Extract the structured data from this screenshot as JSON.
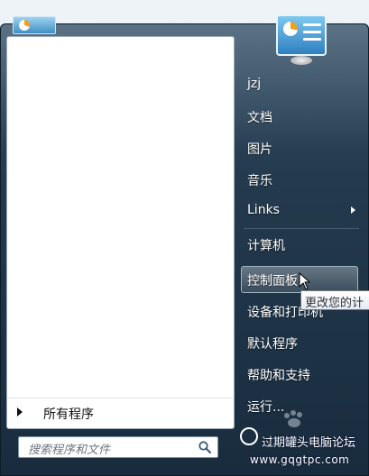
{
  "right_pane": {
    "user": "jzj",
    "items": [
      "文档",
      "图片",
      "音乐",
      "Links",
      "计算机",
      "控制面板",
      "设备和打印机",
      "默认程序",
      "帮助和支持",
      "运行..."
    ]
  },
  "left_pane": {
    "all_programs": "所有程序"
  },
  "search": {
    "placeholder": "搜索程序和文件"
  },
  "tooltip": "更改您的计",
  "watermark": {
    "line1": "过期罐头电脑论坛",
    "line2": "www.gqgtpc.com"
  },
  "colors": {
    "frame": "#1f3a52",
    "highlight_border": "#9cb3c4"
  },
  "icons": [
    "control-panel-icon",
    "search-icon",
    "arrow-right-icon",
    "cursor-icon"
  ]
}
